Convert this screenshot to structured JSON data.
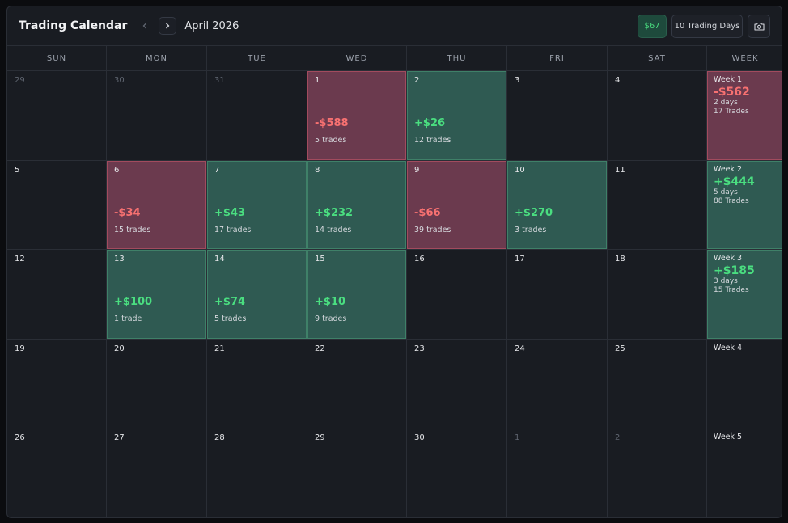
{
  "header": {
    "title": "Trading Calendar",
    "month": "April 2026",
    "total_pnl": "$67",
    "trading_days": "10 Trading Days"
  },
  "colors": {
    "win": "#2f5a52",
    "loss": "#6b3a4e",
    "positive_text": "#4ade80",
    "negative_text": "#f87171"
  },
  "days_of_week": [
    "SUN",
    "MON",
    "TUE",
    "WED",
    "THU",
    "FRI",
    "SAT",
    "WEEK"
  ],
  "weeks": [
    {
      "days": [
        {
          "date": "29",
          "muted": true
        },
        {
          "date": "30",
          "muted": true
        },
        {
          "date": "31",
          "muted": true
        },
        {
          "date": "1",
          "status": "loss",
          "pnl": "-$588",
          "trades": "5 trades"
        },
        {
          "date": "2",
          "status": "win",
          "pnl": "+$26",
          "trades": "12 trades"
        },
        {
          "date": "3"
        },
        {
          "date": "4"
        }
      ],
      "summary": {
        "label": "Week 1",
        "status": "loss",
        "pnl": "-$562",
        "days": "2 days",
        "trades": "17 Trades"
      }
    },
    {
      "days": [
        {
          "date": "5"
        },
        {
          "date": "6",
          "status": "loss",
          "pnl": "-$34",
          "trades": "15 trades"
        },
        {
          "date": "7",
          "status": "win",
          "pnl": "+$43",
          "trades": "17 trades"
        },
        {
          "date": "8",
          "status": "win",
          "pnl": "+$232",
          "trades": "14 trades"
        },
        {
          "date": "9",
          "status": "loss",
          "pnl": "-$66",
          "trades": "39 trades"
        },
        {
          "date": "10",
          "status": "win",
          "pnl": "+$270",
          "trades": "3 trades"
        },
        {
          "date": "11"
        }
      ],
      "summary": {
        "label": "Week 2",
        "status": "win",
        "pnl": "+$444",
        "days": "5 days",
        "trades": "88 Trades"
      }
    },
    {
      "days": [
        {
          "date": "12"
        },
        {
          "date": "13",
          "status": "win",
          "pnl": "+$100",
          "trades": "1 trade"
        },
        {
          "date": "14",
          "status": "win",
          "pnl": "+$74",
          "trades": "5 trades"
        },
        {
          "date": "15",
          "status": "win",
          "pnl": "+$10",
          "trades": "9 trades"
        },
        {
          "date": "16"
        },
        {
          "date": "17"
        },
        {
          "date": "18"
        }
      ],
      "summary": {
        "label": "Week 3",
        "status": "win",
        "pnl": "+$185",
        "days": "3 days",
        "trades": "15 Trades"
      }
    },
    {
      "days": [
        {
          "date": "19"
        },
        {
          "date": "20"
        },
        {
          "date": "21"
        },
        {
          "date": "22"
        },
        {
          "date": "23"
        },
        {
          "date": "24"
        },
        {
          "date": "25"
        }
      ],
      "summary": {
        "label": "Week 4"
      }
    },
    {
      "days": [
        {
          "date": "26"
        },
        {
          "date": "27"
        },
        {
          "date": "28"
        },
        {
          "date": "29"
        },
        {
          "date": "30"
        },
        {
          "date": "1",
          "muted": true
        },
        {
          "date": "2",
          "muted": true
        }
      ],
      "summary": {
        "label": "Week 5"
      }
    }
  ]
}
